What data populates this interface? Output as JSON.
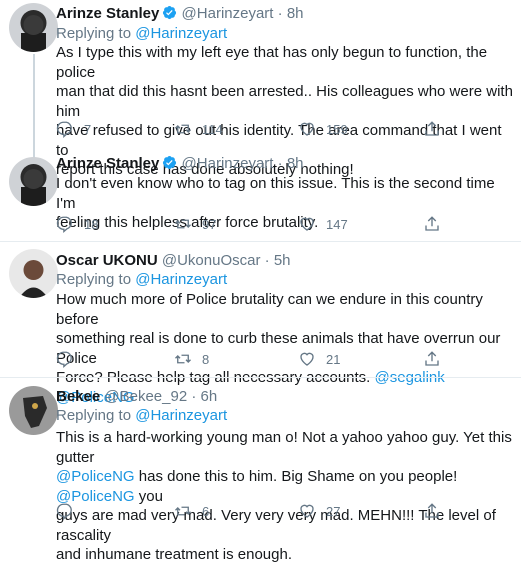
{
  "tweets": [
    {
      "name": "Arinze Stanley",
      "verified": true,
      "handle": "@Harinzeyart",
      "dot": "·",
      "time": "8h",
      "reply_prefix": "Replying to",
      "reply_to": "@Harinzeyart",
      "lines": [
        "As I type this with my left eye that has only begun to function, the police",
        "man that did this hasnt been arrested.. His colleagues who were with him",
        "have refused to give out his identity. The area command that I went to",
        "report this case has done absolutely nothing!"
      ],
      "replies": "7",
      "retweets": "114",
      "likes": "159"
    },
    {
      "name": "Arinze Stanley",
      "verified": true,
      "handle": "@Harinzeyart",
      "dot": "·",
      "time": "8h",
      "lines": [
        "I don't even know who to tag on this issue. This is the second time I'm",
        "feeling this helpless after force brutality."
      ],
      "replies": "18",
      "retweets": "97",
      "likes": "147"
    },
    {
      "name": "Oscar UKONU",
      "handle": "@UkonuOscar",
      "dot": "·",
      "time": "5h",
      "reply_prefix": "Replying to",
      "reply_to": "@Harinzeyart",
      "lines": [
        "How much more of Police brutality can we endure in this country before",
        "something real is done to curb these animals that have overrun our Police",
        "Force? Please help tag all necessary accounts."
      ],
      "mention_1": "@segalink",
      "mention_2": "@PoliceNG",
      "replies": "",
      "retweets": "8",
      "likes": "21"
    },
    {
      "name": "Bekee",
      "handle": "@Bekee_92",
      "dot": "·",
      "time": "6h",
      "reply_prefix": "Replying to",
      "reply_to": "@Harinzeyart",
      "line1": "This is a hard-working young man o! Not a yahoo yahoo guy. Yet this gutter",
      "mention_a": "@PoliceNG",
      "line2_mid": " has done this to him. Big Shame on you people! ",
      "mention_b": "@PoliceNG",
      "line2_end": " you",
      "line3": "guys are mad very mad. Very very very mad. MEHN!!! The level of rascality",
      "line4": "and inhumane treatment is enough.",
      "replies": "",
      "retweets": "6",
      "likes": "27"
    }
  ],
  "icons": {
    "reply": "reply-icon",
    "retweet": "retweet-icon",
    "like": "heart-icon",
    "share": "share-icon",
    "verified": "verified-badge-icon"
  },
  "colors": {
    "link": "#1b95e0",
    "muted": "#657786",
    "verified": "#1da1f2"
  }
}
